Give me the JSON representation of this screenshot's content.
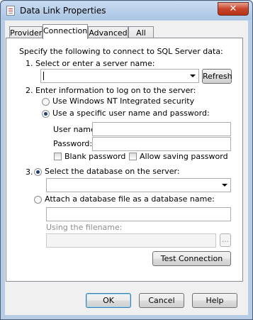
{
  "window": {
    "title": "Data Link Properties",
    "close_glyph": "✕"
  },
  "tabs": [
    {
      "label": "Provider"
    },
    {
      "label": "Connection"
    },
    {
      "label": "Advanced"
    },
    {
      "label": "All"
    }
  ],
  "intro": "Specify the following to connect to SQL Server data:",
  "step1": {
    "label": "1. Select or enter a server name:",
    "server_value": "",
    "refresh_label": "Refresh"
  },
  "step2": {
    "label": "2. Enter information to log on to the server:",
    "option_nt": "Use Windows NT Integrated security",
    "option_specific": "Use a specific user name and password:",
    "selected": "specific",
    "username_label": "User name:",
    "username_value": "",
    "password_label": "Password:",
    "password_value": "",
    "blank_password_label": "Blank password",
    "allow_saving_label": "Allow saving password"
  },
  "step3": {
    "number": "3.",
    "option_select_db": "Select the database on the server:",
    "database_value": "",
    "option_attach": "Attach a database file as a database name:",
    "attach_name_value": "",
    "filename_label": "Using the filename:",
    "filename_value": "",
    "browse_label": "...",
    "test_label": "Test Connection"
  },
  "footer": {
    "ok_label": "OK",
    "cancel_label": "Cancel",
    "help_label": "Help"
  }
}
